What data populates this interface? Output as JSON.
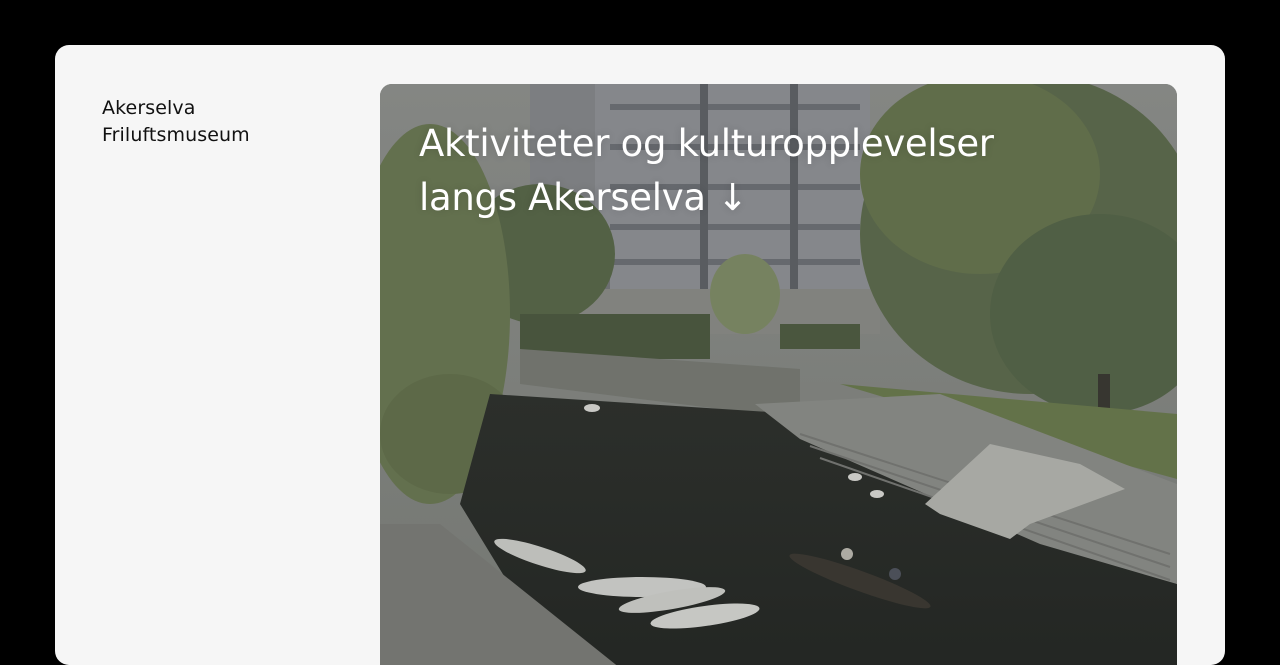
{
  "brand": {
    "line1": "Akerselva",
    "line2": "Friluftsmuseum"
  },
  "hero": {
    "title_line1": "Aktiviteter og kulturopplevelser",
    "title_line2": "langs Akerselva ↓",
    "photo_description": "",
    "scroll_arrow_icon": "arrow-down-icon"
  },
  "colors": {
    "page_background": "#000000",
    "card_background": "#f6f6f6",
    "text_dark": "#111111",
    "text_light": "#ffffff"
  }
}
